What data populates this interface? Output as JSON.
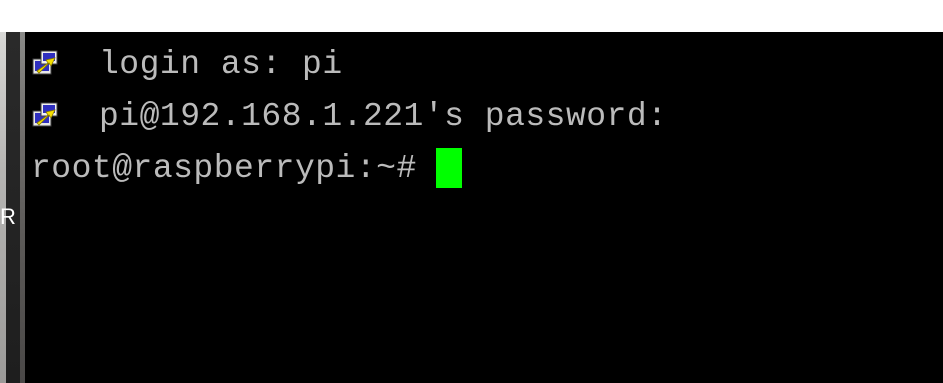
{
  "terminal": {
    "lines": [
      {
        "icon": "putty-icon",
        "text": "login as: pi"
      },
      {
        "icon": "putty-icon",
        "text": "pi@192.168.1.221's password:"
      },
      {
        "icon": "",
        "text": "root@raspberrypi:~#"
      }
    ],
    "cursor_color": "#00ff00",
    "text_color": "#bbbbbb",
    "background_color": "#000000"
  },
  "background_window": {
    "letter": "R"
  }
}
